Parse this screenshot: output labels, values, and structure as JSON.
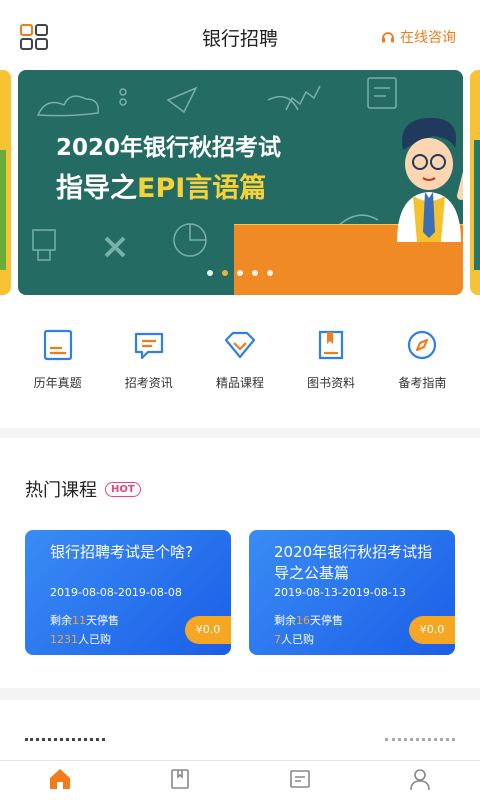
{
  "header": {
    "title": "银行招聘",
    "consult_label": "在线咨询",
    "accent": "#f07c1e"
  },
  "banner": {
    "line1": "2020年银行秋招考试",
    "line2_prefix": "指导之",
    "line2_highlight": "EPI言语篇",
    "slide_count": 5,
    "active_slide": 2
  },
  "quicknav": [
    {
      "label": "历年真题",
      "icon": "document-icon"
    },
    {
      "label": "招考资讯",
      "icon": "message-icon"
    },
    {
      "label": "精品课程",
      "icon": "diamond-icon"
    },
    {
      "label": "图书资料",
      "icon": "book-icon"
    },
    {
      "label": "备考指南",
      "icon": "compass-icon"
    }
  ],
  "hot": {
    "title": "热门课程",
    "badge": "HOT",
    "cards": [
      {
        "title": "银行招聘考试是个啥?",
        "date": "2019-08-08-2019-08-08",
        "remain_prefix": "剩余",
        "remain_num": "11",
        "remain_suffix": "天停售",
        "buyers_num": "1231",
        "buyers_suffix": "人已购",
        "price": "¥0.0"
      },
      {
        "title": "2020年银行秋招考试指导之公基篇",
        "date": "2019-08-13-2019-08-13",
        "remain_prefix": "剩余",
        "remain_num": "16",
        "remain_suffix": "天停售",
        "buyers_num": "7",
        "buyers_suffix": "人已购",
        "price": "¥0.0"
      }
    ]
  },
  "tabbar": [
    {
      "icon": "home-icon",
      "active": true
    },
    {
      "icon": "book-tab-icon",
      "active": false
    },
    {
      "icon": "note-tab-icon",
      "active": false
    },
    {
      "icon": "profile-icon",
      "active": false
    }
  ]
}
